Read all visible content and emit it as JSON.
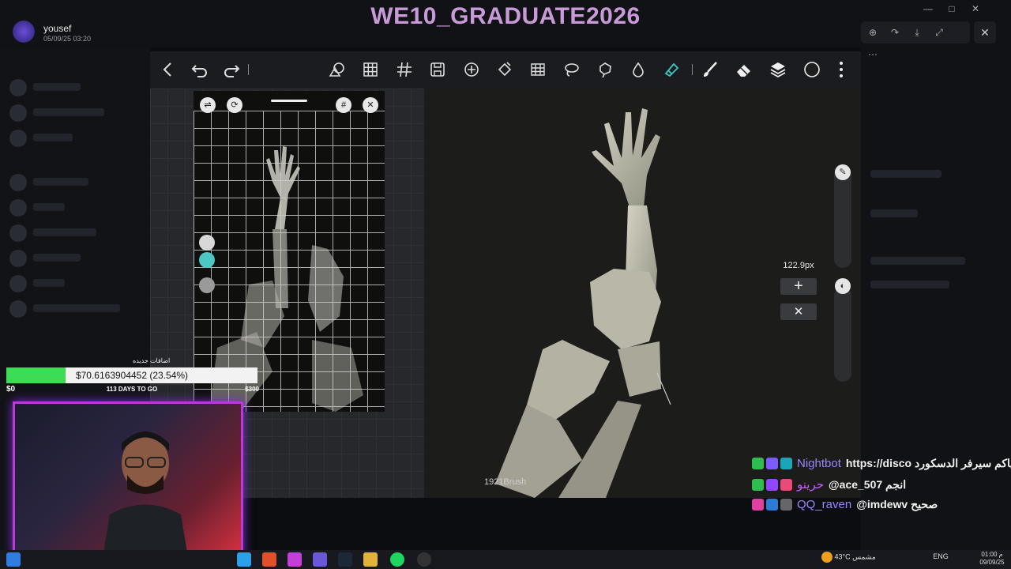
{
  "header": {
    "user_name": "yousef",
    "user_date": "05/09/25 03:20",
    "stream_title": "WE10_GRADUATE2026",
    "window_controls": [
      "—",
      "□",
      "✕"
    ],
    "viewer_tools": [
      "⊕",
      "↷",
      "⤓",
      "⤢",
      "⋯"
    ],
    "viewer_close": "✕"
  },
  "app": {
    "toolbar_icons": [
      "chevron-left-icon",
      "undo-icon",
      "redo-icon",
      "shapes-icon",
      "grid-icon",
      "hash-icon",
      "save-icon",
      "add-circle-icon",
      "fill-icon",
      "table-icon",
      "lasso-icon",
      "shape-select-icon",
      "drop-icon",
      "smudge-icon",
      "brush-icon",
      "eraser-icon",
      "layers-icon",
      "color-icon",
      "more-icon"
    ],
    "size_value": "122.9px",
    "size_plus": "+",
    "size_close": "✕",
    "brush_name": "1921Brush"
  },
  "donation": {
    "title": "اضافات جديده",
    "amount_text": "$70.6163904452 (23.54%)",
    "progress": 0.2354,
    "min_label": "$0",
    "days_label": "113 DAYS TO GO",
    "max_label": "$300"
  },
  "chat": [
    {
      "user": "Nightbot",
      "user_color": "#9b86ff",
      "message": "https://disco حياكم سيرفر الدسكورد",
      "badges": [
        "#2ebd4e",
        "#7b5cff",
        "#19a6b6"
      ]
    },
    {
      "user": "حرينو",
      "user_color": "#c85cff",
      "message": "@ace_507 انجم",
      "badges": [
        "#2ebd4e",
        "#9146ff",
        "#e84a7a"
      ]
    },
    {
      "user": "QQ_raven",
      "user_color": "#9b86ff",
      "message": "@imdewv صحيح",
      "badges": [
        "#e040a0",
        "#2e7bd6",
        "#666"
      ]
    }
  ],
  "taskbar": {
    "weather": "43°C مشمس",
    "lang": "ENG",
    "time": "01:00 م",
    "date": "09/09/25"
  }
}
